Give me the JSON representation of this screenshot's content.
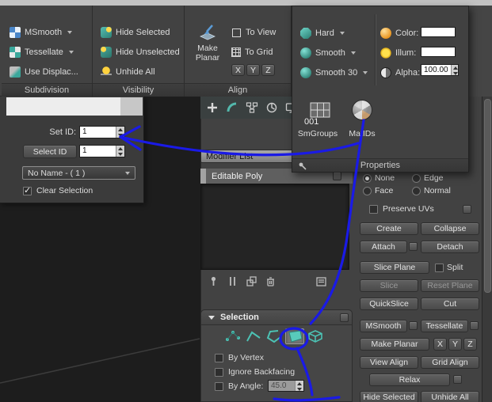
{
  "ribbon": {
    "subdivision": {
      "label": "Subdivision",
      "msmooth": "MSmooth",
      "tessellate": "Tessellate",
      "use_displace": "Use Displac..."
    },
    "visibility": {
      "label": "Visibility",
      "hide_selected": "Hide Selected",
      "hide_unselected": "Hide Unselected",
      "unhide_all": "Unhide All"
    },
    "align": {
      "label": "Align",
      "make_planar": "Make Planar",
      "to_view": "To View",
      "to_grid": "To Grid",
      "x": "X",
      "y": "Y",
      "z": "Z"
    },
    "smoothing": {
      "hard": "Hard",
      "smooth": "Smooth",
      "smooth_30": "Smooth 30"
    },
    "properties": {
      "label": "Properties",
      "color": "Color:",
      "illum": "Illum:",
      "alpha": "Alpha:",
      "alpha_value": "100.00",
      "smgroups": "SmGroups",
      "matids": "MatIDs"
    }
  },
  "id_panel": {
    "set_id": "Set ID:",
    "set_id_value": "1",
    "select_id": "Select ID",
    "select_id_value": "1",
    "name_dropdown": "No Name - ( 1 )",
    "clear_selection": "Clear Selection"
  },
  "command_panel": {
    "object_name": "001",
    "modifier_list": "Modifier List",
    "stack_item": "Editable Poly"
  },
  "selection": {
    "title": "Selection",
    "by_vertex": "By Vertex",
    "ignore_backfacing": "Ignore Backfacing",
    "by_angle": "By Angle:",
    "angle_value": "45.0"
  },
  "edit_geometry": {
    "none": "None",
    "edge": "Edge",
    "face": "Face",
    "normal": "Normal",
    "preserve_uvs": "Preserve UVs",
    "create": "Create",
    "collapse": "Collapse",
    "attach": "Attach",
    "detach": "Detach",
    "slice_plane": "Slice Plane",
    "split": "Split",
    "slice": "Slice",
    "reset_plane": "Reset Plane",
    "quickslice": "QuickSlice",
    "cut": "Cut",
    "msmooth": "MSmooth",
    "tessellate": "Tessellate",
    "make_planar": "Make Planar",
    "x": "X",
    "y": "Y",
    "z": "Z",
    "view_align": "View Align",
    "grid_align": "Grid Align",
    "relax": "Relax",
    "hide_selected": "Hide Selected",
    "unhide_all": "Unhide All"
  },
  "colors": {
    "annotation": "#1a1ae6",
    "teal_icon": "#4cc2b4",
    "accent_blue": "#4a86c8"
  }
}
